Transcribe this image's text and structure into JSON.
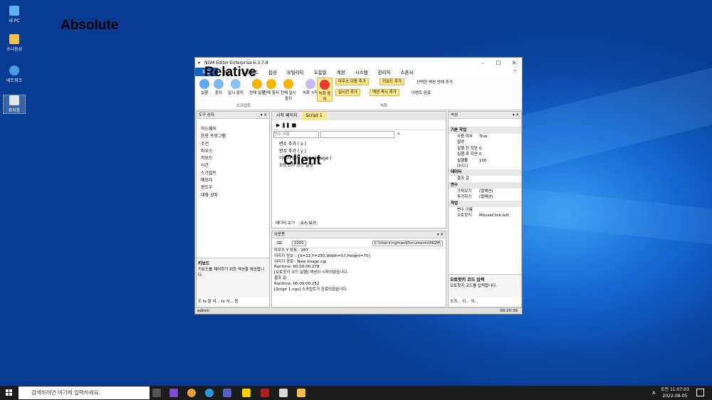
{
  "labels": {
    "absolute": "Absolute",
    "relative": "Relative",
    "client": "Client"
  },
  "desktop": [
    {
      "label": "내 PC",
      "icon": "computer-icon"
    },
    {
      "label": "소니음성",
      "icon": "folder-icon"
    },
    {
      "label": "네트워크",
      "icon": "network-icon"
    },
    {
      "label": "휴지통",
      "icon": "recycle-bin-icon"
    }
  ],
  "window": {
    "title": "NGM Editor   Enterprise 6.3.7.8",
    "menu": [
      "파일",
      "편집",
      "스크립트",
      "옵션",
      "유틸리티",
      "도움말",
      "계정",
      "시스템",
      "관리자",
      "스폰서"
    ],
    "ribbon": {
      "buttons": [
        "실행",
        "중지",
        "일시 중지",
        "전체 실행",
        "전체 중지",
        "전체 일시 중지",
        "녹화 시작",
        "녹화 중지"
      ],
      "group_script": "스크립트",
      "group_record": "녹화",
      "small": [
        "마우스 이동 추가",
        "키보드 추가",
        "선택한 액션 안에 추가",
        "실시간 추가",
        "액션 즉시 추가",
        "이벤트 완료"
      ]
    },
    "toolbox": {
      "title": "도구 상자",
      "items": [
        "하드웨어",
        "응용 프로그램",
        "조건",
        "마우스",
        "키보드",
        "시간",
        "스크립트",
        "메모리",
        "윈도우",
        "대화 상자"
      ],
      "desc_title": "키보드",
      "desc": "키보드를 제어하기 위한 액션을 제공합니다.",
      "tabs": [
        "도",
        "fx 함",
        "사...",
        "fx 사...",
        "등"
      ]
    },
    "doc_tabs": [
      "시작 페이지",
      "Script 1"
    ],
    "search": {
      "placeholder": "변수 이름"
    },
    "script_lines": [
      {
        "text": "변수 추가 ( x )"
      },
      {
        "text": "변수 추가 ( y )"
      },
      {
        "text": "이미지 검색 ( New Image )"
      },
      {
        "text": "오토핫키 코드 실행"
      }
    ],
    "editor_tabs": [
      "에디터 보기",
      "소스 보기"
    ],
    "output": {
      "title": "아웃풋",
      "count": "1000",
      "path": "C:\\Users\\ngmas\\Documents\\NGM\\",
      "lines": [
        "마우스 Y 좌표 : 287",
        "이미지 정보 : {X=12,Y=250,Width=57,Height=75}",
        "이미지 경로 : New Image.ngi",
        "Runtime: 00:00:00.278",
        "[오토핫키 코드 실행] 액션이 시작되었습니다.",
        "결과 값:",
        "Runtime: 00:00:00.252",
        "[Script 1.ngs] 스크립트가 완료되었습니다."
      ]
    },
    "properties": {
      "title": "속성",
      "cats": [
        {
          "name": "기본 작업",
          "rows": [
            [
              "사용 여부",
              "True"
            ],
            [
              "설명",
              ""
            ],
            [
              "실행 전 지연",
              "0"
            ],
            [
              "실행 후 지연",
              "0"
            ],
            [
              "실행률",
              "100"
            ],
            [
              "아이디",
              ""
            ]
          ]
        },
        {
          "name": "데이터",
          "rows": [
            [
              "결과 값",
              ""
            ]
          ]
        },
        {
          "name": "변수",
          "rows": [
            [
              "가져오기",
              "(컬렉션)"
            ],
            [
              "추가하기",
              "(컬렉션)"
            ]
          ]
        },
        {
          "name": "작업",
          "rows": [
            [
              "변수 이름",
              ""
            ],
            [
              "오토핫키",
              "MouseClick,left,"
            ]
          ]
        }
      ],
      "desc_title": "오토핫키 코드 입력",
      "desc": "오토핫키 코드를 입력합니다.",
      "tabs": [
        "스크...",
        "이...",
        "외..."
      ]
    },
    "status": {
      "left": "admin",
      "right": "00:20:39"
    }
  },
  "taskbar": {
    "search": "검색하려면 여기에 입력하세요.",
    "time": "오전 11:07:03",
    "date": "2022-08-05",
    "lang": "A"
  }
}
